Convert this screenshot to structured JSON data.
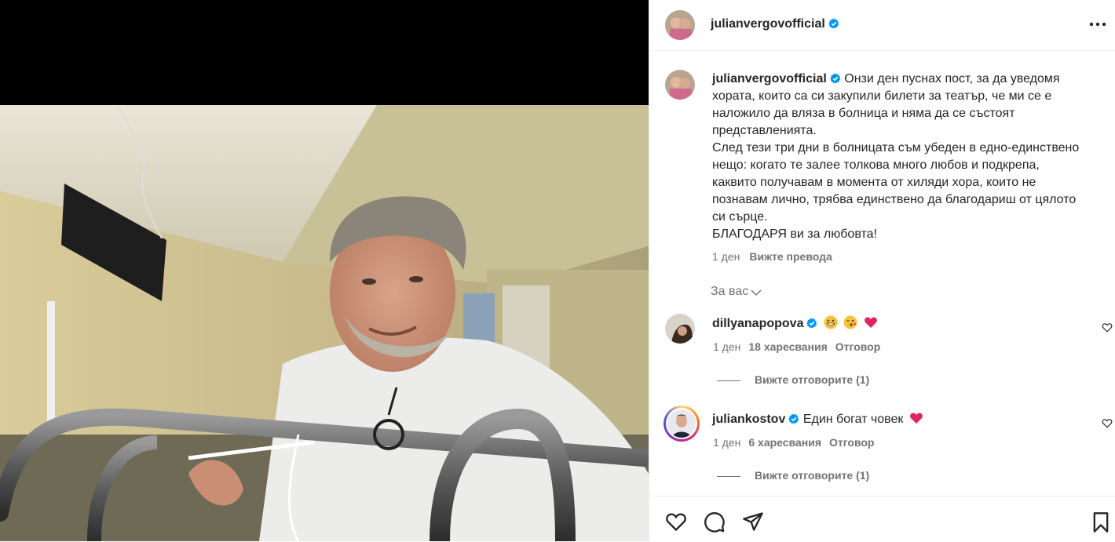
{
  "post": {
    "username": "julianvergovofficial",
    "more_icon": "more-horizontal-icon",
    "caption_lines": [
      "Онзи ден пуснах пост, за да уведомя",
      "хората, които са си закупили билети за театър, че ми се е",
      "наложило да вляза в болница и няма да се състоят",
      "представленията.",
      "След тези три дни в болницата съм убеден в едно-единствено",
      "нещо: когато те залее толкова много любов и подкрепа,",
      "каквито получавам в момента от хиляди хора, които не",
      "познавам лично, трябва единствено да благодариш от цялото",
      "си сърце.",
      "БЛАГОДАРЯ ви за любовта!"
    ],
    "time": "1 ден",
    "translate_label": "Вижте превода",
    "for_you_label": "За вас"
  },
  "comments": [
    {
      "username": "dillyanapopova",
      "text": "",
      "emojis": [
        "grinning-face",
        "winking-kiss-face",
        "red-heart"
      ],
      "time": "1 ден",
      "likes": "18 харесвания",
      "reply_label": "Отговор",
      "view_replies": "Вижте отговорите (1)"
    },
    {
      "username": "juliankostov",
      "text": "Един богат човек",
      "emojis": [
        "red-heart"
      ],
      "time": "1 ден",
      "likes": "6 харесвания",
      "reply_label": "Отговор",
      "view_replies": "Вижте отговорите (1)"
    }
  ],
  "actions": {
    "icons": [
      "heart-icon",
      "comment-icon",
      "share-icon",
      "bookmark-icon"
    ]
  },
  "colors": {
    "verified": "#0095f6",
    "secondary_text": "#737373",
    "heart_red": "#e0245e"
  }
}
